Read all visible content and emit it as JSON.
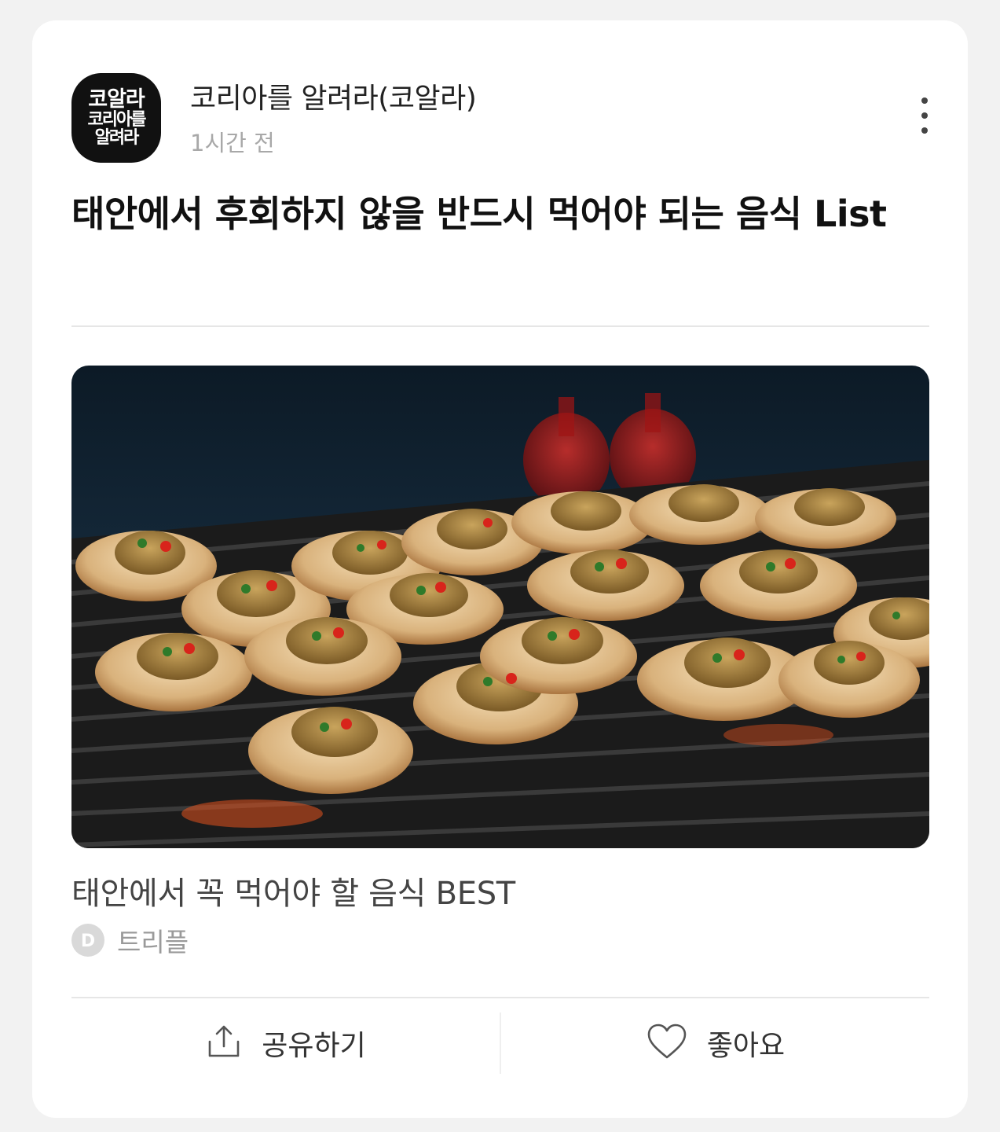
{
  "publisher": {
    "name": "코리아를 알려라(코알라)",
    "logo_lines": [
      "코알라",
      "코리아를",
      "알려라"
    ],
    "posted_time": "1시간 전"
  },
  "post": {
    "title": "태안에서 후회하지 않을 반드시 먹어야 되는 음식 List"
  },
  "link_card": {
    "image_icon": "grilled-scallops-photo",
    "title": "태안에서 꼭 먹어야 할 음식 BEST",
    "source_badge_letter": "D",
    "source_name": "트리플"
  },
  "actions": {
    "share_label": "공유하기",
    "share_icon": "share-upload-icon",
    "like_label": "좋아요",
    "like_icon": "heart-outline-icon"
  },
  "colors": {
    "background": "#f2f2f2",
    "card": "#ffffff",
    "title_text": "#111111",
    "muted_text": "#a8a8a8",
    "divider": "#e6e6e6"
  }
}
